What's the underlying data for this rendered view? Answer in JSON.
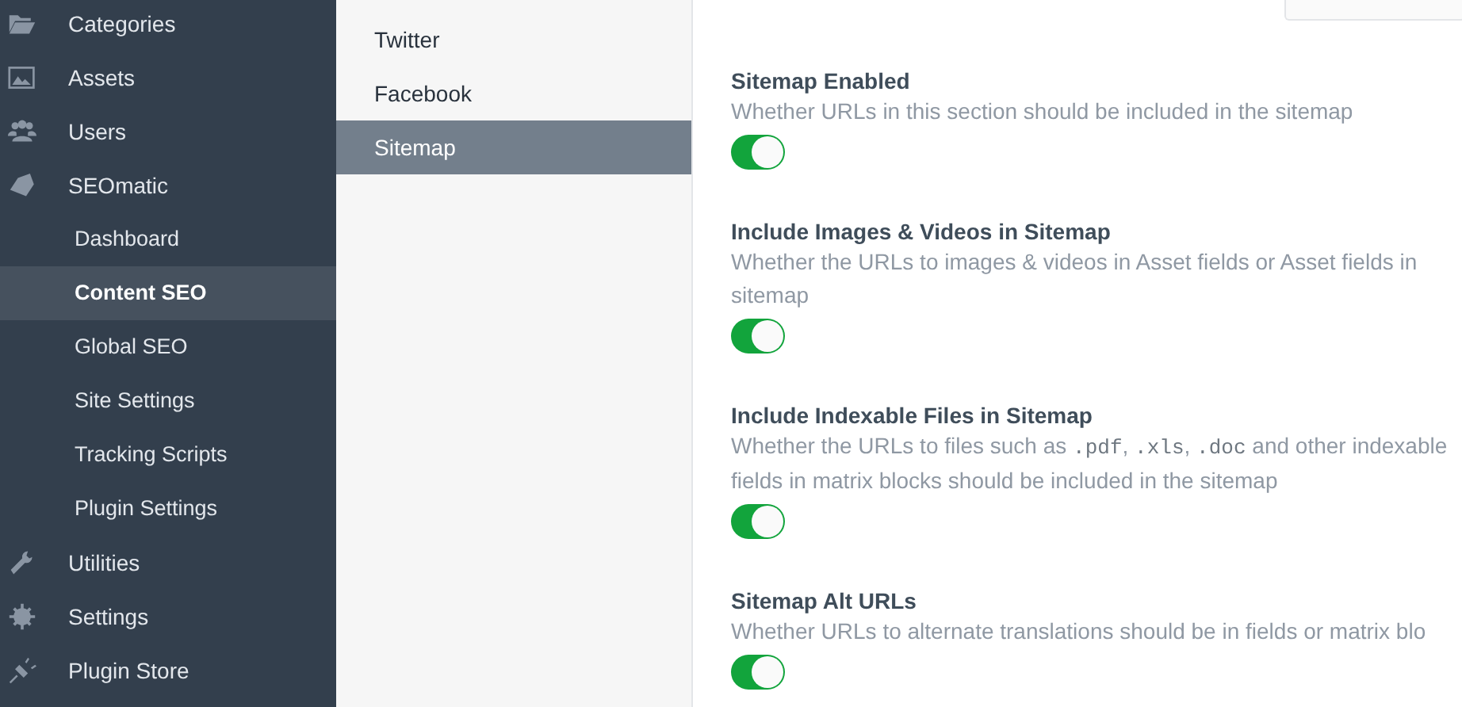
{
  "sidebar": {
    "items": [
      {
        "label": "Categories",
        "selected": false
      },
      {
        "label": "Assets",
        "selected": false
      },
      {
        "label": "Users",
        "selected": false
      },
      {
        "label": "SEOmatic",
        "selected": false,
        "children": [
          {
            "label": "Dashboard",
            "selected": false
          },
          {
            "label": "Content SEO",
            "selected": true
          },
          {
            "label": "Global SEO",
            "selected": false
          },
          {
            "label": "Site Settings",
            "selected": false
          },
          {
            "label": "Tracking Scripts",
            "selected": false
          },
          {
            "label": "Plugin Settings",
            "selected": false
          }
        ]
      },
      {
        "label": "Utilities",
        "selected": false
      },
      {
        "label": "Settings",
        "selected": false
      },
      {
        "label": "Plugin Store",
        "selected": false
      }
    ]
  },
  "subnav": {
    "items": [
      {
        "label": "Twitter",
        "selected": false
      },
      {
        "label": "Facebook",
        "selected": false
      },
      {
        "label": "Sitemap",
        "selected": true
      }
    ]
  },
  "fields": [
    {
      "title": "Sitemap Enabled",
      "on": true,
      "lines": [
        [
          {
            "kind": "text",
            "text": "Whether URLs in this section should be included in the sitemap"
          }
        ]
      ]
    },
    {
      "title": "Include Images & Videos in Sitemap",
      "on": true,
      "lines": [
        [
          {
            "kind": "text",
            "text": "Whether the URLs to images & videos in Asset fields or Asset fields in"
          }
        ],
        [
          {
            "kind": "text",
            "text": "sitemap"
          }
        ]
      ]
    },
    {
      "title": "Include Indexable Files in Sitemap",
      "on": true,
      "lines": [
        [
          {
            "kind": "text",
            "text": "Whether the URLs to files such as "
          },
          {
            "kind": "code",
            "text": ".pdf"
          },
          {
            "kind": "text",
            "text": ", "
          },
          {
            "kind": "code",
            "text": ".xls"
          },
          {
            "kind": "text",
            "text": ", "
          },
          {
            "kind": "code",
            "text": ".doc"
          },
          {
            "kind": "text",
            "text": " and other indexable"
          }
        ],
        [
          {
            "kind": "text",
            "text": "fields in matrix blocks should be included in the sitemap"
          }
        ]
      ]
    },
    {
      "title": "Sitemap Alt URLs",
      "on": true,
      "lines": [
        [
          {
            "kind": "text",
            "text": "Whether URLs to alternate translations should be in fields or matrix blo"
          }
        ]
      ]
    }
  ]
}
